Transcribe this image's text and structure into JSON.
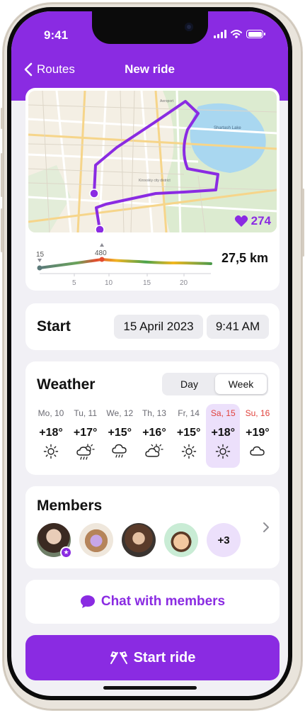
{
  "status_bar": {
    "time": "9:41"
  },
  "nav": {
    "back_label": "Routes",
    "title": "New ride"
  },
  "map": {
    "likes": "274",
    "labels": [
      "Shartash Lake",
      "Kirovskiy city district",
      "Aeroport"
    ]
  },
  "elevation": {
    "start_label": "15",
    "peak_label": "480",
    "ticks": [
      "5",
      "10",
      "15",
      "20"
    ]
  },
  "distance": "27,5 km",
  "start": {
    "title": "Start",
    "date": "15 April 2023",
    "time": "9:41 AM"
  },
  "weather": {
    "title": "Weather",
    "tabs": [
      "Day",
      "Week"
    ],
    "active_tab": "Week",
    "days": [
      {
        "name": "Mo, 10",
        "temp": "+18°",
        "icon": "sun-icon",
        "weekend": false,
        "selected": false
      },
      {
        "name": "Tu, 11",
        "temp": "+17°",
        "icon": "sun-cloud-rain-icon",
        "weekend": false,
        "selected": false
      },
      {
        "name": "We, 12",
        "temp": "+15°",
        "icon": "cloud-rain-icon",
        "weekend": false,
        "selected": false
      },
      {
        "name": "Th, 13",
        "temp": "+16°",
        "icon": "sun-cloud-icon",
        "weekend": false,
        "selected": false
      },
      {
        "name": "Fr, 14",
        "temp": "+15°",
        "icon": "sun-icon",
        "weekend": false,
        "selected": false
      },
      {
        "name": "Sa, 15",
        "temp": "+18°",
        "icon": "sun-icon",
        "weekend": true,
        "selected": true
      },
      {
        "name": "Su, 16",
        "temp": "+19°",
        "icon": "cloud-icon",
        "weekend": true,
        "selected": false
      }
    ]
  },
  "members": {
    "title": "Members",
    "more_count": "+3"
  },
  "chat": {
    "label": "Chat with members"
  },
  "start_ride": {
    "label": "Start ride"
  },
  "colors": {
    "accent": "#8a2be2",
    "accent_light": "#ece0fb",
    "weekend": "#e0413b",
    "water": "#a9d7f0"
  }
}
